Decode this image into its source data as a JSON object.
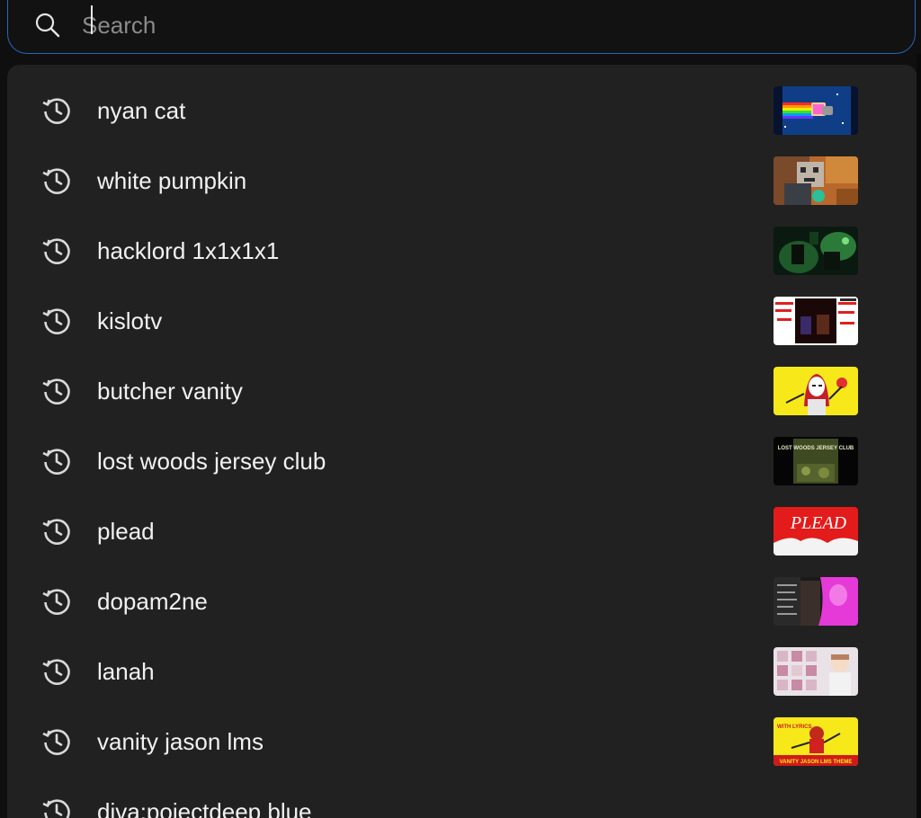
{
  "search": {
    "placeholder": "Search",
    "value": ""
  },
  "suggestions": [
    {
      "label": "nyan cat",
      "type": "history",
      "thumbnail": "nyan-cat-thumbnail"
    },
    {
      "label": "white pumpkin",
      "type": "history",
      "thumbnail": "white-pumpkin-thumbnail"
    },
    {
      "label": "hacklord 1x1x1x1",
      "type": "history",
      "thumbnail": "hacklord-thumbnail"
    },
    {
      "label": "kislotv",
      "type": "history",
      "thumbnail": "kislotv-thumbnail"
    },
    {
      "label": "butcher vanity",
      "type": "history",
      "thumbnail": "butcher-vanity-thumbnail"
    },
    {
      "label": "lost woods jersey club",
      "type": "history",
      "thumbnail": "lost-woods-thumbnail"
    },
    {
      "label": "plead",
      "type": "history",
      "thumbnail": "plead-thumbnail"
    },
    {
      "label": "dopam2ne",
      "type": "history",
      "thumbnail": "dopam2ne-thumbnail"
    },
    {
      "label": "lanah",
      "type": "history",
      "thumbnail": "lanah-thumbnail"
    },
    {
      "label": "vanity jason lms",
      "type": "history",
      "thumbnail": "vanity-jason-thumbnail"
    },
    {
      "label": "diva:pojectdeep blue",
      "type": "history",
      "thumbnail": ""
    }
  ],
  "thumbnail_text": {
    "lost_woods": "LOST WOODS JERSEY CLUB",
    "plead": "PLEAD",
    "vanity_jason_top": "WITH LYRICS",
    "vanity_jason_bottom": "VANITY JASON LMS THEME"
  },
  "colors": {
    "background": "#0f0f0f",
    "dropdown": "#212121",
    "text": "#f1f1f1",
    "icon": "#d9d9d9",
    "focus_border": "#2a63b8"
  }
}
